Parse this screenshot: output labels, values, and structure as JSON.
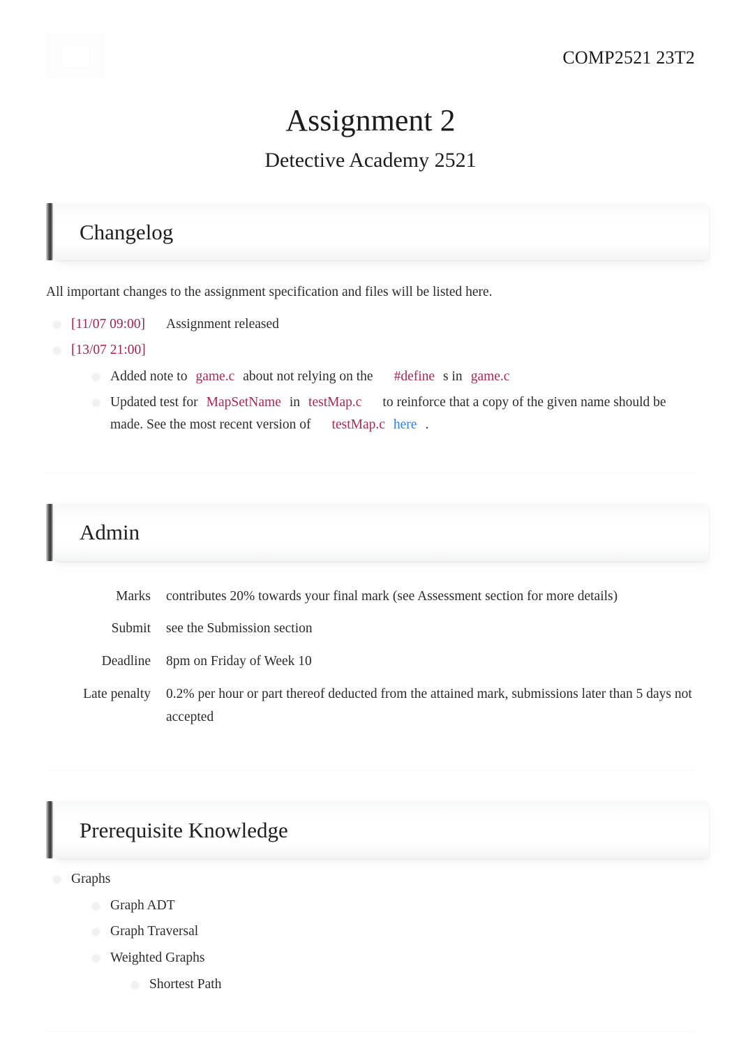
{
  "header": {
    "logo_alt": "course-logo",
    "course_code": "COMP2521 23T2"
  },
  "title": {
    "main": "Assignment 2",
    "subtitle": "Detective Academy 2521"
  },
  "colors": {
    "code_text": "#a52a56",
    "timestamp": "#9d2352",
    "link": "#2f7fec",
    "section_bar": "#3a3a3a",
    "body_text": "#2b2b2b"
  },
  "sections": {
    "changelog": {
      "heading": "Changelog",
      "intro": "All important changes to the assignment specification and files will be listed here.",
      "entries": [
        {
          "timestamp": "[11/07 09:00]",
          "text": "Assignment released",
          "children": []
        },
        {
          "timestamp": "[13/07 21:00]",
          "text": "",
          "children": [
            {
              "part1": "Added note to",
              "code1": "game.c",
              "part2": "about not relying on the",
              "code2": "#define",
              "part3": "s in",
              "code3": "game.c"
            },
            {
              "part1": "Updated test for",
              "code1": "MapSetName",
              "part2": "in",
              "code2": "testMap.c",
              "part3": "to reinforce that a copy of the given name should be made. See the most recent version of",
              "code3": "testMap.c",
              "link_label": "here",
              "part4": "."
            }
          ]
        }
      ]
    },
    "admin": {
      "heading": "Admin",
      "rows": [
        {
          "label": "Marks",
          "value": "contributes 20% towards your final mark (see Assessment section for more details)"
        },
        {
          "label": "Submit",
          "value": "see the Submission section"
        },
        {
          "label": "Deadline",
          "value": "8pm on Friday of Week 10"
        },
        {
          "label": "Late penalty",
          "value": "0.2% per hour or part thereof deducted from the attained mark, submissions later than 5 days not accepted"
        }
      ]
    },
    "prerequisite": {
      "heading": "Prerequisite Knowledge",
      "items": [
        {
          "label": "Graphs",
          "children": [
            {
              "label": "Graph ADT",
              "children": []
            },
            {
              "label": "Graph Traversal",
              "children": []
            },
            {
              "label": "Weighted Graphs",
              "children": [
                {
                  "label": "Shortest Path",
                  "children": []
                }
              ]
            }
          ]
        }
      ]
    }
  }
}
